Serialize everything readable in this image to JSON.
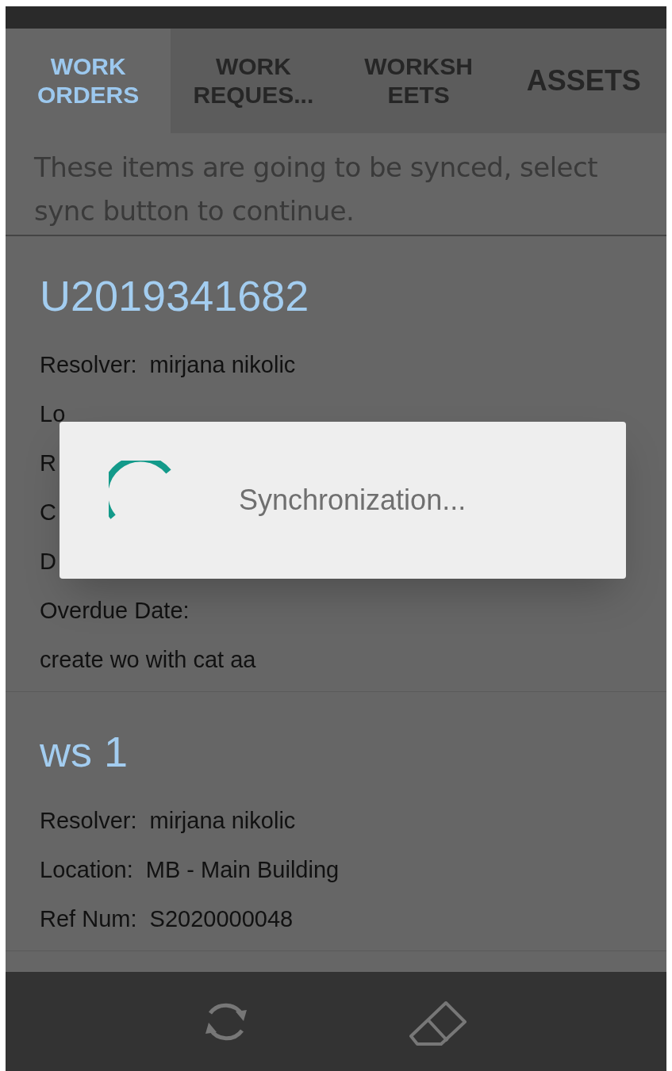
{
  "tabs": [
    {
      "label": "WORK\nORDERS",
      "selected": true
    },
    {
      "label": "WORK\nREQUES...",
      "selected": false
    },
    {
      "label": "WORKSH\nEETS",
      "selected": false
    },
    {
      "label": "ASSETS",
      "selected": false
    }
  ],
  "notice": "These items are going to be synced, select sync button to continue.",
  "items": [
    {
      "title": "U2019341682",
      "lines": [
        "Resolver:  mirjana nikolic",
        "Lo",
        "R",
        "C",
        "D",
        "Overdue Date:",
        "create wo with cat aa"
      ]
    },
    {
      "title": "ws 1",
      "lines": [
        "Resolver:  mirjana nikolic",
        "Location:  MB - Main Building",
        "Ref Num:  S2020000048"
      ]
    }
  ],
  "dialog": {
    "message": "Synchronization..."
  }
}
